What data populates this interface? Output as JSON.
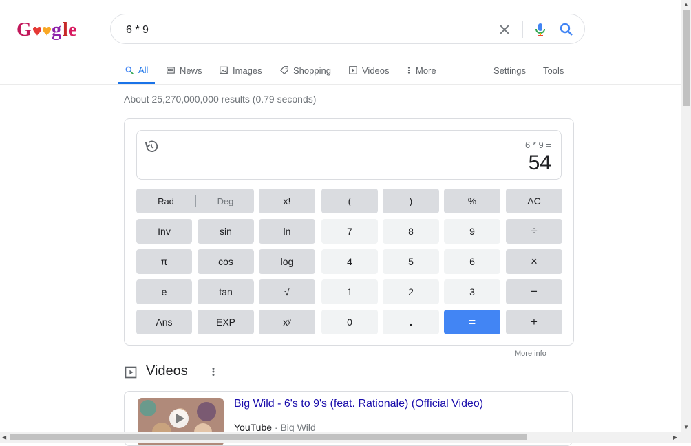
{
  "colors": {
    "accent": "#1a73e8",
    "equals_key": "#4285f4",
    "link": "#1a0dab",
    "muted": "#70757a"
  },
  "search": {
    "query": "6 * 9"
  },
  "tabs": [
    {
      "label": "All",
      "icon": "search-icon"
    },
    {
      "label": "News",
      "icon": "news-icon"
    },
    {
      "label": "Images",
      "icon": "image-icon"
    },
    {
      "label": "Shopping",
      "icon": "tag-icon"
    },
    {
      "label": "Videos",
      "icon": "play-icon"
    },
    {
      "label": "More",
      "icon": "more-vertical-icon"
    }
  ],
  "tools": {
    "settings": "Settings",
    "tools": "Tools"
  },
  "result_stats": "About 25,270,000,000 results (0.79 seconds)",
  "calculator": {
    "expression": "6 * 9 =",
    "result": "54",
    "rad": "Rad",
    "deg": "Deg",
    "keys": {
      "fact": "x!",
      "lparen": "(",
      "rparen": ")",
      "percent": "%",
      "ac": "AC",
      "inv": "Inv",
      "sin": "sin",
      "ln": "ln",
      "seven": "7",
      "eight": "8",
      "nine": "9",
      "divide": "÷",
      "pi": "π",
      "cos": "cos",
      "log": "log",
      "four": "4",
      "five": "5",
      "six": "6",
      "multiply": "×",
      "e": "e",
      "tan": "tan",
      "sqrt": "√",
      "one": "1",
      "two": "2",
      "three": "3",
      "minus": "−",
      "ans": "Ans",
      "exp": "EXP",
      "pow": "xʸ",
      "zero": "0",
      "dot": ".",
      "equals": "=",
      "plus": "+"
    },
    "more_info": "More info"
  },
  "videos": {
    "heading": "Videos",
    "items": [
      {
        "title": "Big Wild - 6's to 9's (feat. Rationale) (Official Video)",
        "source": "YouTube",
        "channel": "Big Wild"
      }
    ]
  }
}
